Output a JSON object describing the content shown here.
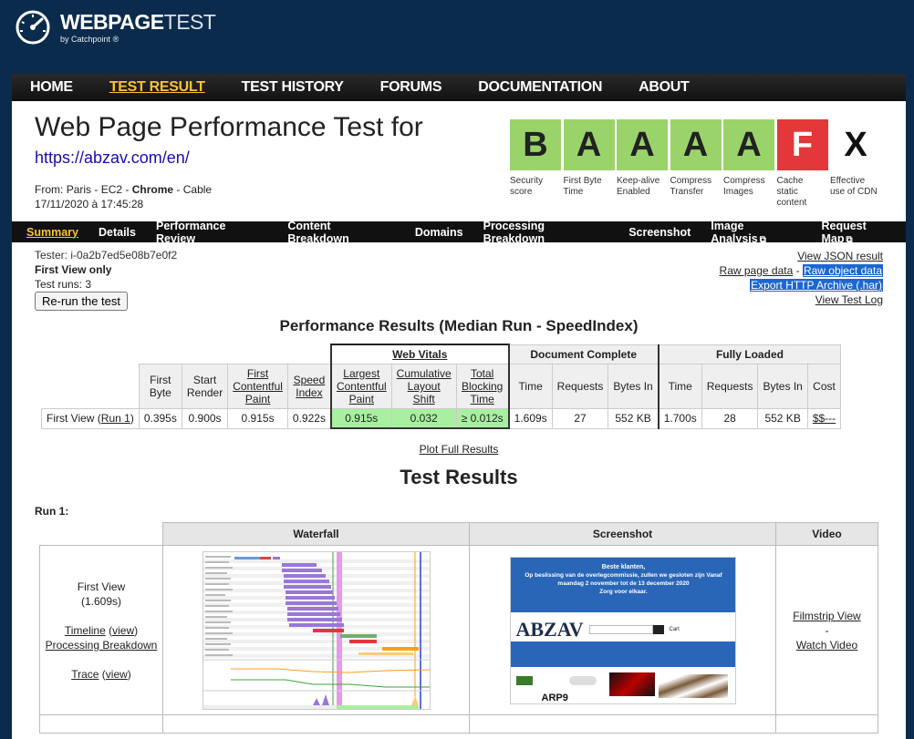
{
  "brand": {
    "name_bold": "WEBPAGE",
    "name_light": "TEST",
    "sub": "by Catchpoint",
    "reg": "®"
  },
  "nav": [
    {
      "label": "HOME",
      "active": false
    },
    {
      "label": "TEST RESULT",
      "active": true
    },
    {
      "label": "TEST HISTORY",
      "active": false
    },
    {
      "label": "FORUMS",
      "active": false
    },
    {
      "label": "DOCUMENTATION",
      "active": false
    },
    {
      "label": "ABOUT",
      "active": false
    }
  ],
  "header": {
    "title": "Web Page Performance Test for",
    "url": "https://abzav.com/en/",
    "from_label": "From:",
    "from_location": "Paris - EC2",
    "from_sep1": " - ",
    "from_browser": "Chrome",
    "from_sep2": " - ",
    "from_conn": "Cable",
    "date": "17/11/2020 à 17:45:28"
  },
  "grades": [
    {
      "grade": "B",
      "label1": "Security",
      "label2": "score",
      "label3": ""
    },
    {
      "grade": "A",
      "label1": "First Byte",
      "label2": "Time",
      "label3": ""
    },
    {
      "grade": "A",
      "label1": "Keep-alive",
      "label2": "Enabled",
      "label3": ""
    },
    {
      "grade": "A",
      "label1": "Compress",
      "label2": "Transfer",
      "label3": ""
    },
    {
      "grade": "A",
      "label1": "Compress",
      "label2": "Images",
      "label3": ""
    },
    {
      "grade": "F",
      "label1": "Cache",
      "label2": "static",
      "label3": "content"
    },
    {
      "grade": "X",
      "label1": "Effective",
      "label2": "use of CDN",
      "label3": ""
    }
  ],
  "grade_colors": {
    "good": "#9bd36b",
    "bad": "#e3373a"
  },
  "subnav": [
    {
      "label": "Summary",
      "active": true,
      "ext": false
    },
    {
      "label": "Details",
      "active": false,
      "ext": false
    },
    {
      "label": "Performance Review",
      "active": false,
      "ext": false
    },
    {
      "label": "Content Breakdown",
      "active": false,
      "ext": false
    },
    {
      "label": "Domains",
      "active": false,
      "ext": false
    },
    {
      "label": "Processing Breakdown",
      "active": false,
      "ext": false
    },
    {
      "label": "Screenshot",
      "active": false,
      "ext": false
    },
    {
      "label": "Image Analysis",
      "active": false,
      "ext": true
    },
    {
      "label": "Request Map",
      "active": false,
      "ext": true
    }
  ],
  "test_info": {
    "tester": "Tester: i-0a2b7ed5e08b7e0f2",
    "first_view_only": "First View only",
    "test_runs": "Test runs: 3",
    "rerun": "Re-run the test"
  },
  "right_links": {
    "json": "View JSON result",
    "raw_page": "Raw page data",
    "dash": " - ",
    "raw_object": "Raw object data",
    "har": "Export HTTP Archive (.har)",
    "log": "View Test Log"
  },
  "perf": {
    "title": "Performance Results (Median Run - SpeedIndex)",
    "groups": {
      "web_vitals": "Web Vitals",
      "doc_complete": "Document Complete",
      "fully_loaded": "Fully Loaded"
    },
    "cols": {
      "first_byte_1": "First",
      "first_byte_2": "Byte",
      "start_render_1": "Start",
      "start_render_2": "Render",
      "fcp_1": "First",
      "fcp_2": "Contentful",
      "fcp_3": "Paint",
      "si_1": "Speed",
      "si_2": "Index",
      "lcp_1": "Largest",
      "lcp_2": "Contentful",
      "lcp_3": "Paint",
      "cls_1": "Cumulative",
      "cls_2": "Layout",
      "cls_3": "Shift",
      "tbt_1": "Total",
      "tbt_2": "Blocking",
      "tbt_3": "Time",
      "time": "Time",
      "requests": "Requests",
      "bytes_in": "Bytes In",
      "cost": "Cost"
    },
    "row": {
      "label": "First View (",
      "run_link": "Run 1",
      "label_end": ")",
      "first_byte": "0.395s",
      "start_render": "0.900s",
      "fcp": "0.915s",
      "speed_index": "0.922s",
      "lcp": "0.915s",
      "cls": "0.032",
      "tbt": "≥ 0.012s",
      "doc_time": "1.609s",
      "doc_requests": "27",
      "doc_bytes": "552 KB",
      "full_time": "1.700s",
      "full_requests": "28",
      "full_bytes": "552 KB",
      "cost": "$$---"
    },
    "plot_link": "Plot Full Results",
    "good_color": "#a8f0a0"
  },
  "results": {
    "title": "Test Results",
    "run_label": "Run 1:",
    "headers": {
      "waterfall": "Waterfall",
      "screenshot": "Screenshot",
      "video": "Video"
    },
    "first_view": "First View",
    "first_view_time": "(1.609s)",
    "timeline": "Timeline",
    "view1": "view",
    "processing": "Processing Breakdown",
    "trace": "Trace",
    "view2": "view",
    "filmstrip": "Filmstrip View",
    "dash": "-",
    "watch": "Watch Video"
  },
  "screenshot": {
    "banner1": "Beste klanten,",
    "banner2": "Op beslissing van de overlegcommissie, zullen we gesloten zijn Vanaf",
    "banner3": "maandag 2 november tot de 13 december 2020",
    "banner4": "Zorg voor elkaar.",
    "logo": "ABZAV",
    "cart": "Cart",
    "arp": "ARP9"
  }
}
